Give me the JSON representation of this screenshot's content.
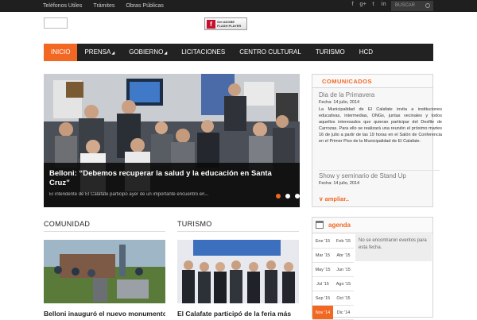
{
  "topbar": {
    "links": [
      "Teléfonos Utiles",
      "Trámites",
      "Obras Públicas"
    ],
    "social": [
      {
        "icon": "facebook-icon",
        "glyph": "f"
      },
      {
        "icon": "googleplus-icon",
        "glyph": "g+"
      },
      {
        "icon": "twitter-icon",
        "glyph": "t"
      },
      {
        "icon": "linkedin-icon",
        "glyph": "in"
      }
    ],
    "search_placeholder": "BUSCAR"
  },
  "flash": {
    "line1": "Get ADOBE",
    "line2": "FLASH PLAYER"
  },
  "nav": [
    {
      "label": "INICIO",
      "active": true,
      "submenu": false
    },
    {
      "label": "PRENSA",
      "active": false,
      "submenu": true
    },
    {
      "label": "GOBIERNO",
      "active": false,
      "submenu": true
    },
    {
      "label": "LICITACIONES",
      "active": false,
      "submenu": false
    },
    {
      "label": "CENTRO CULTURAL",
      "active": false,
      "submenu": false
    },
    {
      "label": "TURISMO",
      "active": false,
      "submenu": false
    },
    {
      "label": "HCD",
      "active": false,
      "submenu": false
    }
  ],
  "slider": {
    "title": "Belloni: “Debemos recuperar la salud y la educación en Santa Cruz”",
    "text": "El intendente de El Calafate participó ayer de un importante encuentro en...",
    "dots": 3,
    "active_dot": 0
  },
  "comunidad": {
    "heading": "COMUNIDAD",
    "caption": "Belloni inauguró el nuevo monumento"
  },
  "turismo": {
    "heading": "TURISMO",
    "caption": "El Calafate participó de la feria más"
  },
  "comunicados": {
    "heading": "COMUNICADOS",
    "items": [
      {
        "title": "Dia de la Primavera",
        "date": "Fecha: 14 julio, 2014",
        "body": "La Municipalidad de El Calafate invita a instituciones educativas, intermedias, ONGs, juntas vecinales y todos aquellos interesados que quieran participar del Desfile de Carrozas. Para ello se realizará una reunión el próximo martes 16 de julio a partir de las 19 horas en el Salón de Conferencia en el Primer Piso de la Municipalidad de El Calafate."
      },
      {
        "title": "Show y seminario de Stand Up",
        "date": "Fecha: 14 julio, 2014",
        "body": ""
      }
    ],
    "more": "∨ ampliar.."
  },
  "agenda": {
    "heading": "agenda",
    "message": "No se encontraron eventos para esta fecha.",
    "months": [
      [
        "Ene '15",
        "Feb '15"
      ],
      [
        "Mar '15",
        "Abr '15"
      ],
      [
        "May '15",
        "Jun '15"
      ],
      [
        "Jul '15",
        "Ago '15"
      ],
      [
        "Sep '15",
        "Oct '15"
      ],
      [
        "Nov '14",
        "Dic '14"
      ]
    ],
    "selected": "Nov '14"
  },
  "colors": {
    "accent": "#f26722",
    "nav_bg": "#222222",
    "topbar_bg": "#1f1f1f"
  }
}
